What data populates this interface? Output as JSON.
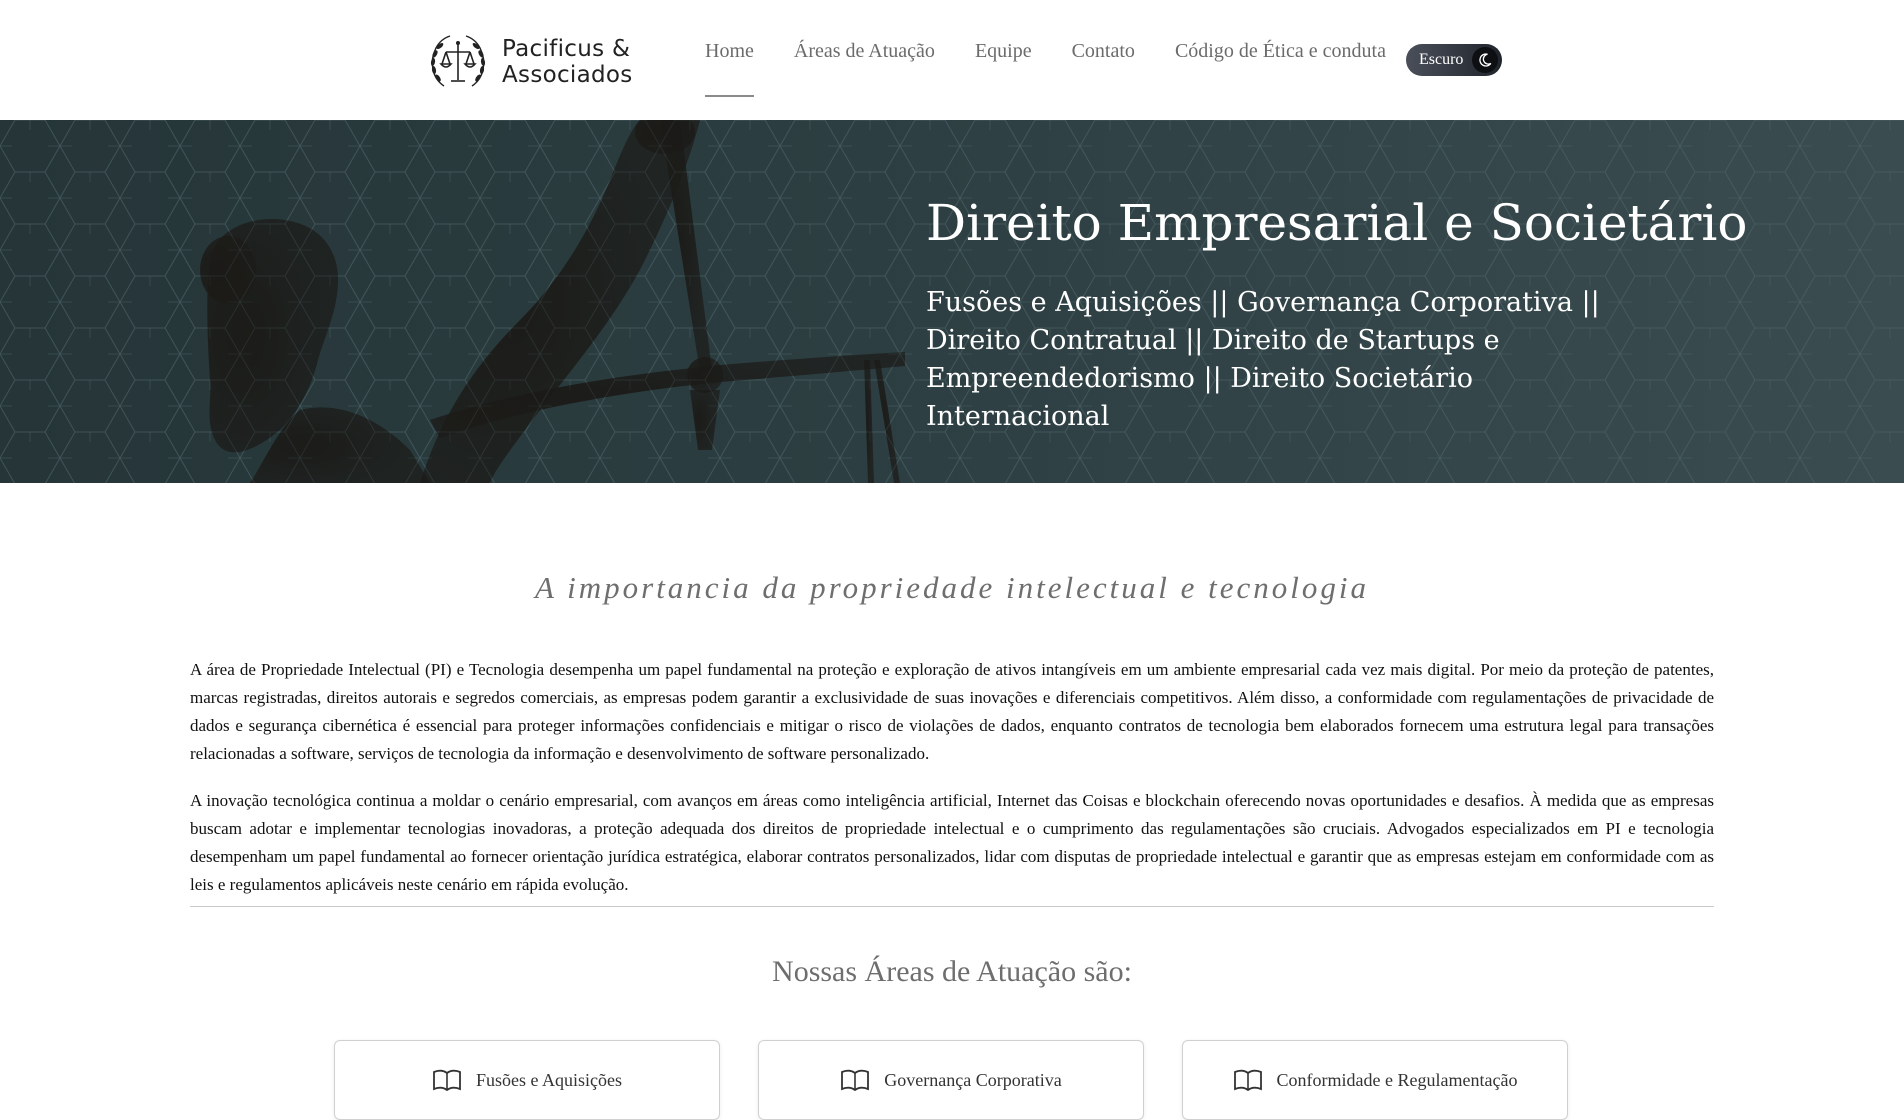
{
  "brand": {
    "name_line1": "Pacificus &",
    "name_line2": "Associados"
  },
  "nav": {
    "items": [
      {
        "label": "Home",
        "active": true
      },
      {
        "label": "Áreas de Atuação",
        "active": false
      },
      {
        "label": "Equipe",
        "active": false
      },
      {
        "label": "Contato",
        "active": false
      },
      {
        "label": "Código de Ética e conduta",
        "active": false
      }
    ],
    "theme_toggle": {
      "label": "Escuro",
      "icon": "moon-icon"
    }
  },
  "hero": {
    "title": "Direito Empresarial e Societário",
    "subtitle": "Fusões e Aquisições || Governança Corporativa || Direito Contratual || Direito de Startups e Empreendedorismo || Direito Societário Internacional"
  },
  "main": {
    "section_title": "A importancia da propriedade intelectual e tecnologia",
    "paragraphs": [
      "A área de Propriedade Intelectual (PI) e Tecnologia desempenha um papel fundamental na proteção e exploração de ativos intangíveis em um ambiente empresarial cada vez mais digital. Por meio da proteção de patentes, marcas registradas, direitos autorais e segredos comerciais, as empresas podem garantir a exclusividade de suas inovações e diferenciais competitivos. Além disso, a conformidade com regulamentações de privacidade de dados e segurança cibernética é essencial para proteger informações confidenciais e mitigar o risco de violações de dados, enquanto contratos de tecnologia bem elaborados fornecem uma estrutura legal para transações relacionadas a software, serviços de tecnologia da informação e desenvolvimento de software personalizado.",
      "A inovação tecnológica continua a moldar o cenário empresarial, com avanços em áreas como inteligência artificial, Internet das Coisas e blockchain oferecendo novas oportunidades e desafios. À medida que as empresas buscam adotar e implementar tecnologias inovadoras, a proteção adequada dos direitos de propriedade intelectual e o cumprimento das regulamentações são cruciais. Advogados especializados em PI e tecnologia desempenham um papel fundamental ao fornecer orientação jurídica estratégica, elaborar contratos personalizados, lidar com disputas de propriedade intelectual e garantir que as empresas estejam em conformidade com as leis e regulamentos aplicáveis neste cenário em rápida evolução."
    ],
    "areas_title": "Nossas Áreas de Atuação são:",
    "cards": [
      {
        "label": "Fusões e Aquisições",
        "icon": "book-icon"
      },
      {
        "label": "Governança Corporativa",
        "icon": "book-icon"
      },
      {
        "label": "Conformidade e Regulamentação",
        "icon": "book-icon"
      }
    ]
  },
  "colors": {
    "hero_bg": "#2b3d40",
    "toggle_bg": "#2c3038",
    "nav_text": "#6b6b6b",
    "heading_gray": "#6e6e6e"
  }
}
